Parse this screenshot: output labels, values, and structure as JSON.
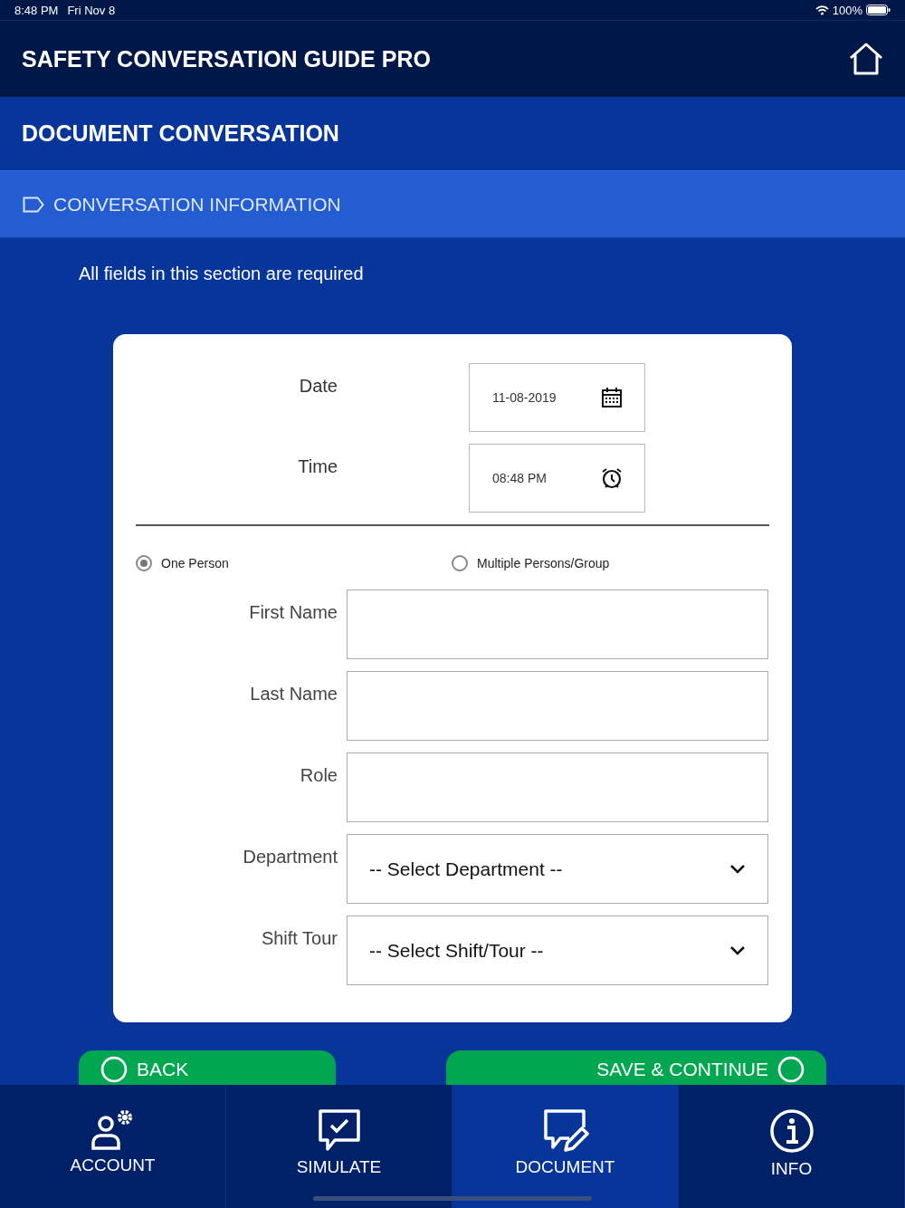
{
  "status_bar": {
    "time": "8:48 PM",
    "date": "Fri Nov 8",
    "battery": "100%"
  },
  "app_title": "SAFETY CONVERSATION GUIDE PRO",
  "page_title": "DOCUMENT CONVERSATION",
  "section": {
    "title": "CONVERSATION INFORMATION"
  },
  "note": "All fields in this section are required",
  "datetime_fields": [
    {
      "kind": "date",
      "label": "Date",
      "value": "11-08-2019"
    },
    {
      "kind": "time",
      "label": "Time",
      "value": "08:48 PM"
    }
  ],
  "participant_options": [
    {
      "label": "One Person",
      "selected": true
    },
    {
      "label": "Multiple Persons/Group",
      "selected": false
    }
  ],
  "fields": [
    {
      "kind": "text",
      "label": "First Name"
    },
    {
      "kind": "text",
      "label": "Last Name"
    },
    {
      "kind": "text",
      "label": "Role"
    },
    {
      "kind": "select",
      "label": "Department",
      "value": "-- Select Department --"
    },
    {
      "kind": "select",
      "label": "Shift Tour",
      "value": "-- Select Shift/Tour --"
    }
  ],
  "buttons": [
    {
      "kind": "back",
      "label": "BACK"
    },
    {
      "kind": "next",
      "label": "SAVE & CONTINUE"
    }
  ],
  "tabs": [
    {
      "kind": "account",
      "label": "ACCOUNT",
      "selected": false
    },
    {
      "kind": "simulate",
      "label": "SIMULATE",
      "selected": false
    },
    {
      "kind": "document",
      "label": "DOCUMENT",
      "selected": true
    },
    {
      "kind": "info",
      "label": "INFO",
      "selected": false
    }
  ]
}
